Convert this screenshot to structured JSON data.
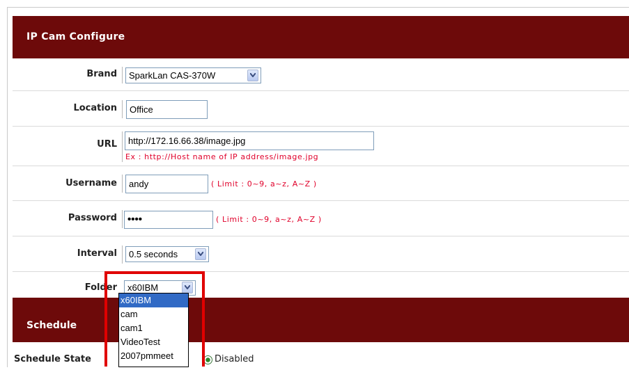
{
  "header": {
    "title": "IP Cam Configure"
  },
  "fields": {
    "brand": {
      "label": "Brand",
      "value": "SparkLan CAS-370W"
    },
    "location": {
      "label": "Location",
      "value": "Office"
    },
    "url": {
      "label": "URL",
      "value": "http://172.16.66.38/image.jpg",
      "hint": "Ex : http://Host name of IP address/image.jpg"
    },
    "username": {
      "label": "Username",
      "value": "andy",
      "hint": "( Limit : 0~9, a~z, A~Z )"
    },
    "password": {
      "label": "Password",
      "value": "••••",
      "hint": "( Limit : 0~9, a~z, A~Z )"
    },
    "interval": {
      "label": "Interval",
      "value": "0.5 seconds"
    },
    "folder": {
      "label": "Folder",
      "value": "x60IBM",
      "options": [
        "x60IBM",
        "cam",
        "cam1",
        "VideoTest",
        "2007pmmeet"
      ]
    }
  },
  "schedule": {
    "title": "Schedule",
    "state_label": "Schedule State",
    "state_value": "Disabled"
  },
  "colors": {
    "header_bg": "#6d0a0a",
    "hint": "#e0002a",
    "highlight_box": "#e00000",
    "selected_option": "#316ac5"
  },
  "icons": {
    "dropdown_arrow": "chevron-down-icon",
    "radio": "radio-selected-icon"
  }
}
